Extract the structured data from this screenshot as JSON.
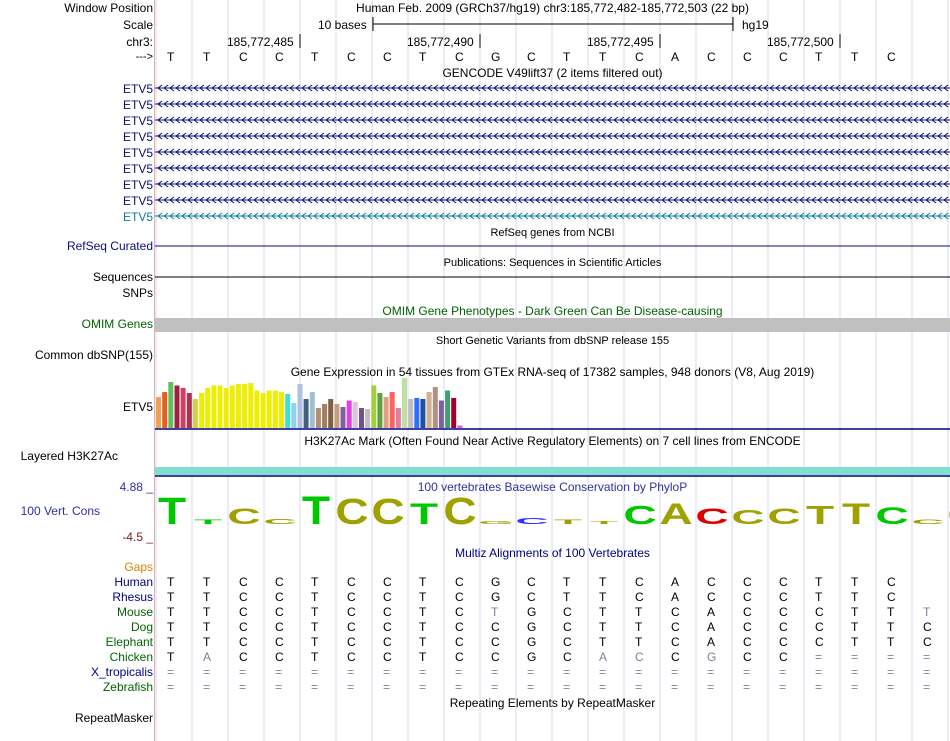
{
  "colors": {
    "navy": "#000080",
    "gene_blue": "#0c0c78",
    "etv5_highlight": "#0c7c9c",
    "omim_green": "#006400",
    "gaps_orange": "#e08000",
    "h3k27ac_teal": "#7ee0d0",
    "phylop_green": "#00c800",
    "phylop_olive": "#a0a000",
    "phylop_red": "#e00000",
    "phylop_blue": "#3030ff",
    "maroon": "#7a2020"
  },
  "labels": {
    "window_position": "Window Position",
    "scale": "Scale",
    "chrom": "chr3:",
    "strand": "--->",
    "refseq": "RefSeq Curated",
    "sequences": "Sequences",
    "snps": "SNPs",
    "omim": "OMIM Genes",
    "common_dbsnp": "Common dbSNP(155)",
    "gtex_gene": "ETV5",
    "h3k27ac": "Layered H3K27Ac",
    "phylop_max": "4.88 _",
    "phylop_name": "100 Vert. Cons",
    "phylop_min": "-4.5 _",
    "gaps": "Gaps",
    "repeatmasker": "RepeatMasker"
  },
  "header": {
    "position_title": "Human Feb. 2009 (GRCh37/hg19)   chr3:185,772,482-185,772,503 (22 bp)",
    "scale_text": "10 bases",
    "assembly": "hg19",
    "ticks": [
      "185,772,485",
      "185,772,490",
      "185,772,495",
      "185,772,500"
    ]
  },
  "sequence": [
    "T",
    "T",
    "C",
    "C",
    "T",
    "C",
    "C",
    "T",
    "C",
    "G",
    "C",
    "T",
    "T",
    "C",
    "A",
    "C",
    "C",
    "C",
    "T",
    "T",
    "C"
  ],
  "tracks": {
    "gencode_title": "GENCODE V49lift37 (2 items filtered out)",
    "gencode_items": [
      "ETV5",
      "ETV5",
      "ETV5",
      "ETV5",
      "ETV5",
      "ETV5",
      "ETV5",
      "ETV5",
      "ETV5"
    ],
    "refseq_title": "RefSeq genes from NCBI",
    "publications_title": "Publications: Sequences in Scientific Articles",
    "omim_title": "OMIM Gene Phenotypes - Dark Green Can Be Disease-causing",
    "dbsnp_title": "Short Genetic Variants from dbSNP release 155",
    "gtex_title": "Gene Expression in 54 tissues from GTEx RNA-seq of 17382 samples, 948 donors (V8, Aug 2019)",
    "h3k27ac_title": "H3K27Ac Mark (Often Found Near Active Regulatory Elements) on 7 cell lines from ENCODE",
    "phylop_title": "100 vertebrates Basewise Conservation by PhyloP",
    "multiz_title": "Multiz Alignments of 100 Vertebrates",
    "repeatmasker_title": "Repeating Elements by RepeatMasker"
  },
  "gtex_bars": [
    {
      "v": 0.62,
      "c": "#f0a050"
    },
    {
      "v": 0.72,
      "c": "#e06020"
    },
    {
      "v": 0.92,
      "c": "#60c060"
    },
    {
      "v": 0.85,
      "c": "#a02040"
    },
    {
      "v": 0.8,
      "c": "#d04060"
    },
    {
      "v": 0.7,
      "c": "#b03050"
    },
    {
      "v": 0.58,
      "c": "#d0d050"
    },
    {
      "v": 0.7,
      "c": "#eeee00"
    },
    {
      "v": 0.8,
      "c": "#eeee00"
    },
    {
      "v": 0.85,
      "c": "#eeee00"
    },
    {
      "v": 0.85,
      "c": "#eeee00"
    },
    {
      "v": 0.8,
      "c": "#eeee00"
    },
    {
      "v": 0.85,
      "c": "#eeee00"
    },
    {
      "v": 0.88,
      "c": "#eeee00"
    },
    {
      "v": 0.88,
      "c": "#eeee00"
    },
    {
      "v": 0.9,
      "c": "#eeee00"
    },
    {
      "v": 0.75,
      "c": "#eeee00"
    },
    {
      "v": 0.7,
      "c": "#eeee00"
    },
    {
      "v": 0.75,
      "c": "#eeee00"
    },
    {
      "v": 0.75,
      "c": "#eeee00"
    },
    {
      "v": 0.72,
      "c": "#eeee00"
    },
    {
      "v": 0.68,
      "c": "#40e0d0"
    },
    {
      "v": 0.5,
      "c": "#90d0f0"
    },
    {
      "v": 0.88,
      "c": "#b0c0e0"
    },
    {
      "v": 0.58,
      "c": "#406080"
    },
    {
      "v": 0.72,
      "c": "#a0c0d0"
    },
    {
      "v": 0.4,
      "c": "#b09070"
    },
    {
      "v": 0.48,
      "c": "#a08060"
    },
    {
      "v": 0.58,
      "c": "#806040"
    },
    {
      "v": 0.48,
      "c": "#c0a080"
    },
    {
      "v": 0.42,
      "c": "#8060a0"
    },
    {
      "v": 0.55,
      "c": "#e040e0"
    },
    {
      "v": 0.52,
      "c": "#e0c0e0"
    },
    {
      "v": 0.4,
      "c": "#705090"
    },
    {
      "v": 0.38,
      "c": "#c0c0c0"
    },
    {
      "v": 0.85,
      "c": "#a0d040"
    },
    {
      "v": 0.7,
      "c": "#60a040"
    },
    {
      "v": 0.62,
      "c": "#e0a080"
    },
    {
      "v": 0.72,
      "c": "#ff6060"
    },
    {
      "v": 0.4,
      "c": "#e080a0"
    },
    {
      "v": 1.0,
      "c": "#c0e0a0"
    },
    {
      "v": 0.58,
      "c": "#c0c0c0"
    },
    {
      "v": 0.6,
      "c": "#3070ff"
    },
    {
      "v": 0.58,
      "c": "#2050a0"
    },
    {
      "v": 0.72,
      "c": "#d0b090"
    },
    {
      "v": 0.82,
      "c": "#b09080"
    },
    {
      "v": 0.55,
      "c": "#8060a0"
    },
    {
      "v": 0.75,
      "c": "#40a070"
    },
    {
      "v": 0.6,
      "c": "#a00030"
    },
    {
      "v": 0.05,
      "c": "#e060e0"
    }
  ],
  "phylop": [
    {
      "h": 0.95,
      "c": "phylop_green"
    },
    {
      "h": 0.15,
      "c": "phylop_green"
    },
    {
      "h": 0.55,
      "c": "phylop_olive"
    },
    {
      "h": 0.18,
      "c": "phylop_olive"
    },
    {
      "h": 1.0,
      "c": "phylop_green"
    },
    {
      "h": 0.9,
      "c": "phylop_olive"
    },
    {
      "h": 0.9,
      "c": "phylop_olive"
    },
    {
      "h": 0.75,
      "c": "phylop_green"
    },
    {
      "h": 0.95,
      "c": "phylop_olive"
    },
    {
      "h": 0.12,
      "c": "phylop_olive"
    },
    {
      "h": 0.2,
      "c": "phylop_blue"
    },
    {
      "h": 0.15,
      "c": "phylop_olive"
    },
    {
      "h": 0.12,
      "c": "phylop_olive"
    },
    {
      "h": 0.65,
      "c": "phylop_green"
    },
    {
      "h": 0.75,
      "c": "phylop_olive"
    },
    {
      "h": 0.55,
      "c": "phylop_red"
    },
    {
      "h": 0.5,
      "c": "phylop_olive"
    },
    {
      "h": 0.55,
      "c": "phylop_olive"
    },
    {
      "h": 0.65,
      "c": "phylop_olive"
    },
    {
      "h": 0.75,
      "c": "phylop_olive"
    },
    {
      "h": 0.6,
      "c": "phylop_green"
    },
    {
      "h": 0.15,
      "c": "phylop_olive"
    },
    {
      "h": 0.7,
      "c": "phylop_olive"
    }
  ],
  "alignment": [
    {
      "species": "Human",
      "color": "#000080",
      "bases": [
        "T",
        "T",
        "C",
        "C",
        "T",
        "C",
        "C",
        "T",
        "C",
        "G",
        "C",
        "T",
        "T",
        "C",
        "A",
        "C",
        "C",
        "C",
        "T",
        "T",
        "C"
      ],
      "gray": []
    },
    {
      "species": "Rhesus",
      "color": "#000080",
      "bases": [
        "T",
        "T",
        "C",
        "C",
        "T",
        "C",
        "C",
        "T",
        "C",
        "G",
        "C",
        "T",
        "T",
        "C",
        "A",
        "C",
        "C",
        "C",
        "T",
        "T",
        "C"
      ],
      "gray": []
    },
    {
      "species": "Mouse",
      "color": "#006400",
      "bases": [
        "T",
        "T",
        "C",
        "C",
        "T",
        "C",
        "C",
        "T",
        "C",
        "T",
        "G",
        "C",
        "T",
        "T",
        "C",
        "A",
        "C",
        "C",
        "C",
        "T",
        "T",
        "T"
      ],
      "gray": [
        9,
        21
      ]
    },
    {
      "species": "Dog",
      "color": "#006400",
      "bases": [
        "T",
        "T",
        "C",
        "C",
        "T",
        "C",
        "C",
        "T",
        "C",
        "C",
        "G",
        "C",
        "T",
        "T",
        "C",
        "A",
        "C",
        "C",
        "C",
        "T",
        "T",
        "C"
      ],
      "gray": []
    },
    {
      "species": "Elephant",
      "color": "#006400",
      "bases": [
        "T",
        "T",
        "C",
        "C",
        "T",
        "C",
        "C",
        "T",
        "C",
        "C",
        "G",
        "C",
        "T",
        "T",
        "C",
        "A",
        "C",
        "C",
        "C",
        "T",
        "T",
        "C"
      ],
      "gray": []
    },
    {
      "species": "Chicken",
      "color": "#006400",
      "bases": [
        "T",
        "A",
        "C",
        "C",
        "T",
        "C",
        "C",
        "T",
        "C",
        "C",
        "G",
        "C",
        "A",
        "C",
        "C",
        "G",
        "C",
        "C",
        "=",
        "=",
        "=",
        "="
      ],
      "gray": [
        1,
        12,
        13,
        15,
        18,
        19,
        20,
        21
      ]
    },
    {
      "species": "X_tropicalis",
      "color": "#000080",
      "bases": [
        "=",
        "=",
        "=",
        "=",
        "=",
        "=",
        "=",
        "=",
        "=",
        "=",
        "=",
        "=",
        "=",
        "=",
        "=",
        "=",
        "=",
        "=",
        "=",
        "=",
        "=",
        "="
      ],
      "gray": [
        0,
        1,
        2,
        3,
        4,
        5,
        6,
        7,
        8,
        9,
        10,
        11,
        12,
        13,
        14,
        15,
        16,
        17,
        18,
        19,
        20,
        21
      ]
    },
    {
      "species": "Zebrafish",
      "color": "#006400",
      "bases": [
        "=",
        "=",
        "=",
        "=",
        "=",
        "=",
        "=",
        "=",
        "=",
        "=",
        "=",
        "=",
        "=",
        "=",
        "=",
        "=",
        "=",
        "=",
        "=",
        "=",
        "=",
        "="
      ],
      "gray": [
        0,
        1,
        2,
        3,
        4,
        5,
        6,
        7,
        8,
        9,
        10,
        11,
        12,
        13,
        14,
        15,
        16,
        17,
        18,
        19,
        20,
        21
      ]
    }
  ]
}
